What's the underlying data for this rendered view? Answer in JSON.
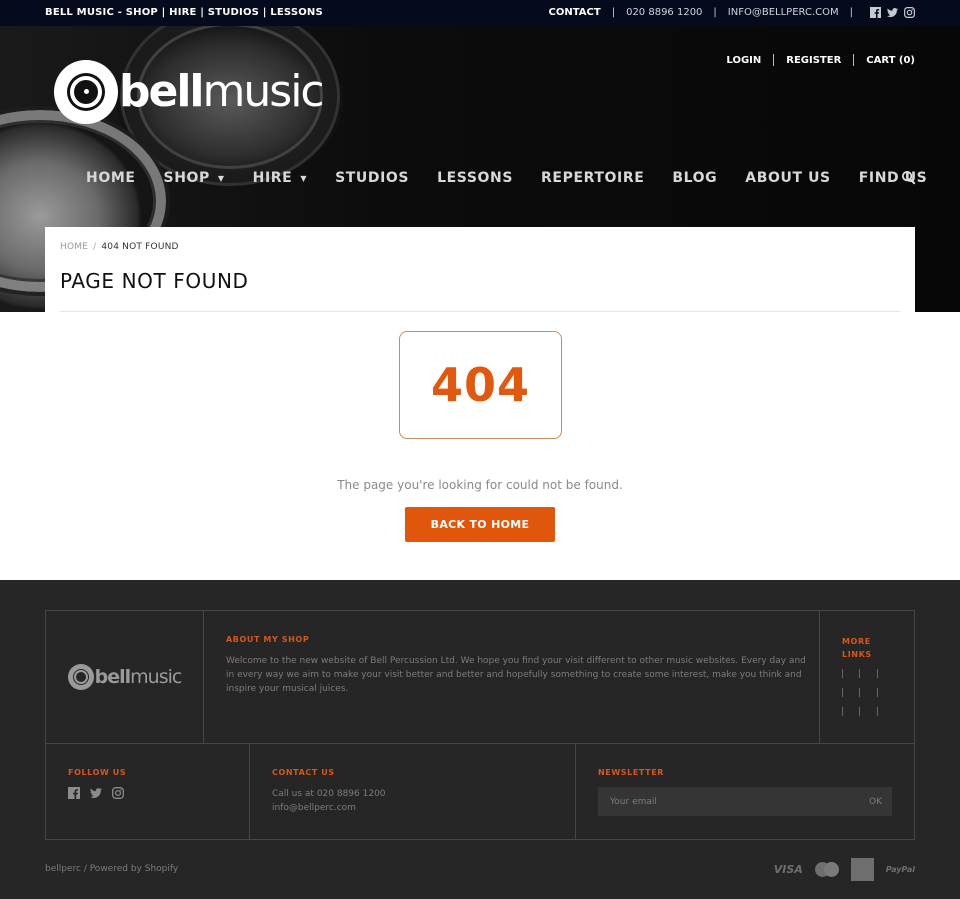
{
  "topbar": {
    "tagline": "BELL MUSIC - SHOP | HIRE | STUDIOS | LESSONS",
    "contact_label": "CONTACT",
    "sep": "|",
    "phone": "020 8896 1200",
    "email": "INFO@BELLPERC.COM",
    "social": [
      "facebook-icon",
      "twitter-icon",
      "instagram-icon"
    ]
  },
  "header": {
    "logo": {
      "bold": "bell",
      "light": "music"
    },
    "account": {
      "login": "LOGIN",
      "register": "REGISTER",
      "cart": "CART (0)"
    },
    "nav": [
      {
        "label": "HOME",
        "dropdown": false
      },
      {
        "label": "SHOP",
        "dropdown": true
      },
      {
        "label": "HIRE",
        "dropdown": true
      },
      {
        "label": "STUDIOS",
        "dropdown": false
      },
      {
        "label": "LESSONS",
        "dropdown": false
      },
      {
        "label": "REPERTOIRE",
        "dropdown": false
      },
      {
        "label": "BLOG",
        "dropdown": false
      },
      {
        "label": "ABOUT US",
        "dropdown": false
      },
      {
        "label": "FIND US",
        "dropdown": false
      }
    ],
    "caret": "▼",
    "search_icon": "search-icon"
  },
  "breadcrumb": {
    "home": "HOME",
    "sep": "/",
    "current": "404 NOT FOUND"
  },
  "page": {
    "title": "PAGE NOT FOUND",
    "code": "404",
    "message": "The page you're looking for could not be found.",
    "back_button": "BACK TO HOME"
  },
  "footer": {
    "logo": {
      "bold": "bell",
      "light": "music"
    },
    "about": {
      "heading": "ABOUT MY SHOP",
      "text": "Welcome to the new website of Bell Percussion Ltd. We hope you find your visit different to other music websites. Every day and in every way we aim to make your visit better and better and hopefully something to create some interest, make you think and inspire your musical juices."
    },
    "more_links": {
      "heading": "MORE LINKS"
    },
    "follow": {
      "heading": "FOLLOW US"
    },
    "contact": {
      "heading": "CONTACT US",
      "phone_line": "Call us at 020 8896 1200",
      "email": "info@bellperc.com"
    },
    "newsletter": {
      "heading": "NEWSLETTER",
      "placeholder": "Your email",
      "submit": "OK"
    },
    "credit": "bellperc / Powered by Shopify",
    "payments": {
      "visa": "VISA",
      "paypal": "PayPal"
    }
  },
  "colors": {
    "accent": "#e0560b",
    "topbar": "#050a1c",
    "footer": "#262626"
  }
}
